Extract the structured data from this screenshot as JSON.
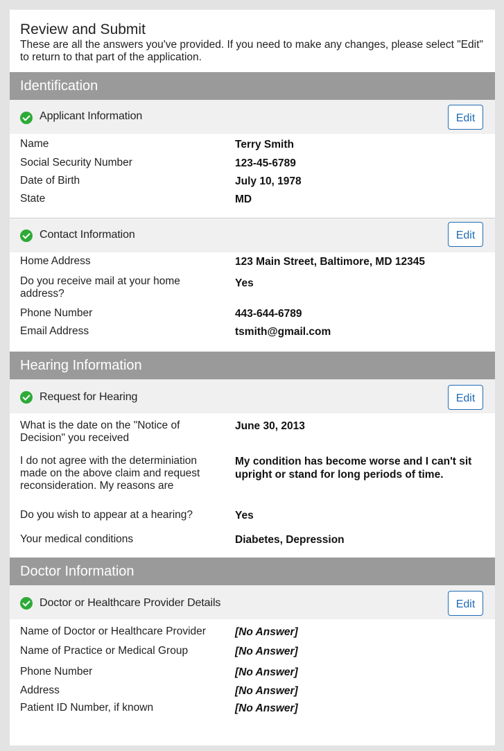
{
  "page": {
    "title": "Review and Submit",
    "description": "These are all the answers you've provided. If you need to make any changes, please select \"Edit\" to return to that part of the application."
  },
  "sections": [
    {
      "title": "Identification",
      "subsections": [
        {
          "title": "Applicant Information",
          "edit_label": "Edit",
          "rows": [
            {
              "label": "Name",
              "value": "Terry Smith"
            },
            {
              "label": "Social Security Number",
              "value": "123-45-6789"
            },
            {
              "label": "Date of Birth",
              "value": "July 10, 1978"
            },
            {
              "label": "State",
              "value": "MD"
            }
          ]
        },
        {
          "title": "Contact Information",
          "edit_label": "Edit",
          "rows": [
            {
              "label": "Home Address",
              "value": "123 Main Street, Baltimore, MD 12345"
            },
            {
              "label": "Do you receive mail at your home address?",
              "value": "Yes"
            },
            {
              "label": "Phone Number",
              "value": "443-644-6789"
            },
            {
              "label": "Email Address",
              "value": "tsmith@gmail.com"
            }
          ]
        }
      ]
    },
    {
      "title": "Hearing Information",
      "subsections": [
        {
          "title": "Request for Hearing",
          "edit_label": "Edit",
          "rows": [
            {
              "label": "What is the date on the \"Notice of Decision\" you received",
              "value": "June 30, 2013"
            },
            {
              "label": "I do not agree with the determiniation made on the above claim and request reconsideration. My reasons are",
              "value": "My condition has become worse and I can't sit upright or stand for long periods of time."
            },
            {
              "label": "Do you wish to appear at a hearing?",
              "value": "Yes"
            },
            {
              "label": "Your medical conditions",
              "value": "Diabetes, Depression"
            }
          ]
        }
      ]
    },
    {
      "title": "Doctor Information",
      "subsections": [
        {
          "title": "Doctor or Healthcare Provider Details",
          "edit_label": "Edit",
          "rows": [
            {
              "label": "Name of Doctor or Healthcare Provider",
              "value": "[No Answer]"
            },
            {
              "label": "Name of Practice or Medical Group",
              "value": "[No Answer]"
            },
            {
              "label": "Phone Number",
              "value": "[No Answer]"
            },
            {
              "label": "Address",
              "value": "[No Answer]"
            },
            {
              "label": "Patient ID Number, if known",
              "value": "[No Answer]"
            }
          ]
        }
      ]
    }
  ],
  "colors": {
    "section_band": "#9a9a9a",
    "subsection_bg": "#f0f0f0",
    "check_green": "#2eaa38",
    "edit_blue": "#1f6bb5"
  }
}
